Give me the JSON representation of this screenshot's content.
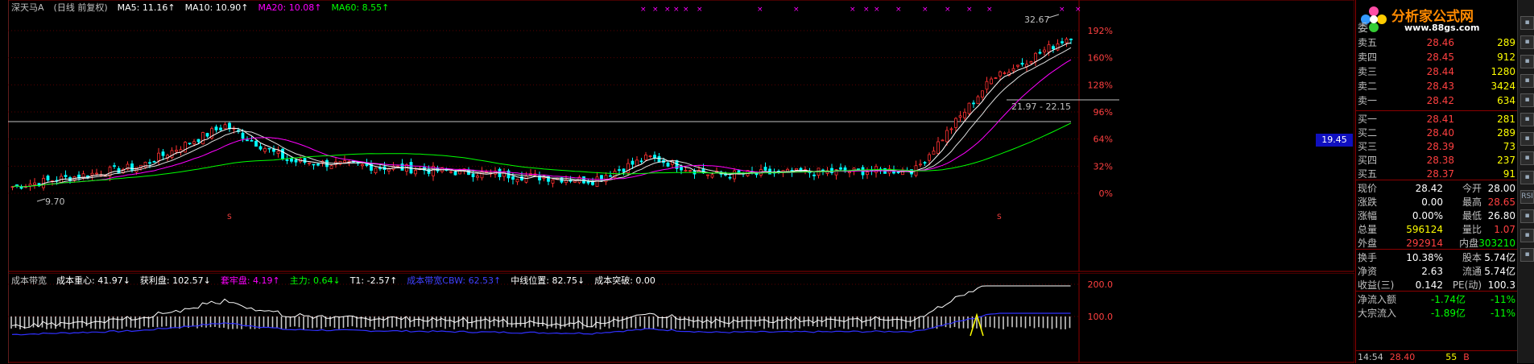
{
  "main_legend": [
    {
      "text": "深天马A",
      "color": "#c0c0c0"
    },
    {
      "text": "(日线 前复权)",
      "color": "#c0c0c0"
    },
    {
      "text": "MA5: 11.16↑",
      "color": "#ffffff"
    },
    {
      "text": "MA10: 10.90↑",
      "color": "#ffffff"
    },
    {
      "text": "MA20: 10.08↑",
      "color": "#ff00ff"
    },
    {
      "text": "MA60: 8.55↑",
      "color": "#00ff00"
    }
  ],
  "sub_legend": [
    {
      "text": "成本带宽",
      "color": "#c0c0c0"
    },
    {
      "text": "成本重心: 41.97↓",
      "color": "#ffffff"
    },
    {
      "text": "获利盘: 102.57↓",
      "color": "#ffffff"
    },
    {
      "text": "套牢盘: 4.19↑",
      "color": "#ff00ff"
    },
    {
      "text": "主力: 0.64↓",
      "color": "#00ff00"
    },
    {
      "text": "T1: -2.57↑",
      "color": "#ffffff"
    },
    {
      "text": "成本带宽CBW: 62.53↑",
      "color": "#4040ff"
    },
    {
      "text": "中线位置: 82.75↓",
      "color": "#ffffff"
    },
    {
      "text": "成本突破: 0.00",
      "color": "#ffffff"
    }
  ],
  "price_flag": "19.45",
  "logo": {
    "title": "分析家公式网",
    "url": "www.88gs.com"
  },
  "chart_data": [
    {
      "type": "line",
      "name": "main",
      "y_ticks": [
        "192%",
        "160%",
        "128%",
        "96%",
        "64%",
        "32%",
        "0%"
      ],
      "y_tick_values": [
        192,
        160,
        128,
        96,
        64,
        32,
        0
      ],
      "annotations": [
        "32.67",
        "21.97 - 22.15",
        "9.70"
      ],
      "series": [
        {
          "name": "MA5",
          "color": "#ffffff"
        },
        {
          "name": "MA10",
          "color": "#ffffff"
        },
        {
          "name": "MA20",
          "color": "#ff00ff"
        },
        {
          "name": "MA60",
          "color": "#00ff00"
        }
      ]
    },
    {
      "type": "bar",
      "name": "sub",
      "y_ticks": [
        "200.0",
        "100.0"
      ],
      "y_tick_values": [
        200,
        100
      ]
    }
  ],
  "quote": {
    "header": "委",
    "asks": [
      {
        "label": "卖五",
        "price": "28.46",
        "vol": "289"
      },
      {
        "label": "卖四",
        "price": "28.45",
        "vol": "912"
      },
      {
        "label": "卖三",
        "price": "28.44",
        "vol": "1280"
      },
      {
        "label": "卖二",
        "price": "28.43",
        "vol": "3424"
      },
      {
        "label": "卖一",
        "price": "28.42",
        "vol": "634"
      }
    ],
    "bids": [
      {
        "label": "买一",
        "price": "28.41",
        "vol": "281"
      },
      {
        "label": "买二",
        "price": "28.40",
        "vol": "289"
      },
      {
        "label": "买三",
        "price": "28.39",
        "vol": "73"
      },
      {
        "label": "买四",
        "price": "28.38",
        "vol": "237"
      },
      {
        "label": "买五",
        "price": "28.37",
        "vol": "91"
      }
    ],
    "stats": [
      {
        "l1": "现价",
        "v1": "28.42",
        "l2": "今开",
        "v2": "28.00",
        "c1": "#ffffff",
        "c2": "#ffffff"
      },
      {
        "l1": "涨跌",
        "v1": "0.00",
        "l2": "最高",
        "v2": "28.65",
        "c1": "#ffffff",
        "c2": "#ff4040"
      },
      {
        "l1": "涨幅",
        "v1": "0.00%",
        "l2": "最低",
        "v2": "26.80",
        "c1": "#ffffff",
        "c2": "#ffffff"
      },
      {
        "l1": "总量",
        "v1": "596124",
        "l2": "量比",
        "v2": "1.07",
        "c1": "#ffff00",
        "c2": "#ff4040"
      },
      {
        "l1": "外盘",
        "v1": "292914",
        "l2": "内盘",
        "v2": "303210",
        "c1": "#ff4040",
        "c2": "#00ff00"
      }
    ],
    "fund": [
      {
        "l1": "换手",
        "v1": "10.38%",
        "l2": "股本",
        "v2": "5.74亿"
      },
      {
        "l1": "净资",
        "v1": "2.63",
        "l2": "流通",
        "v2": "5.74亿"
      },
      {
        "l1": "收益(三)",
        "v1": "0.142",
        "l2": "PE(动)",
        "v2": "100.3"
      }
    ],
    "flows": [
      {
        "label": "净流入额",
        "value": "-1.74亿",
        "pct": "-11%"
      },
      {
        "label": "大宗流入",
        "value": "-1.89亿",
        "pct": "-11%"
      }
    ]
  },
  "timebar": {
    "time": "14:54",
    "price": "28.40",
    "vol": "55",
    "side": "B"
  },
  "toolbar": {
    "buttons": [
      "",
      "",
      "",
      "",
      "",
      "",
      "",
      "",
      "",
      "RSI",
      "",
      "",
      ""
    ]
  },
  "colors": {
    "up": "#ff3030",
    "down": "#00ffff",
    "ma5": "#ffffff",
    "ma20": "#ff00ff",
    "ma60": "#00ff00"
  }
}
